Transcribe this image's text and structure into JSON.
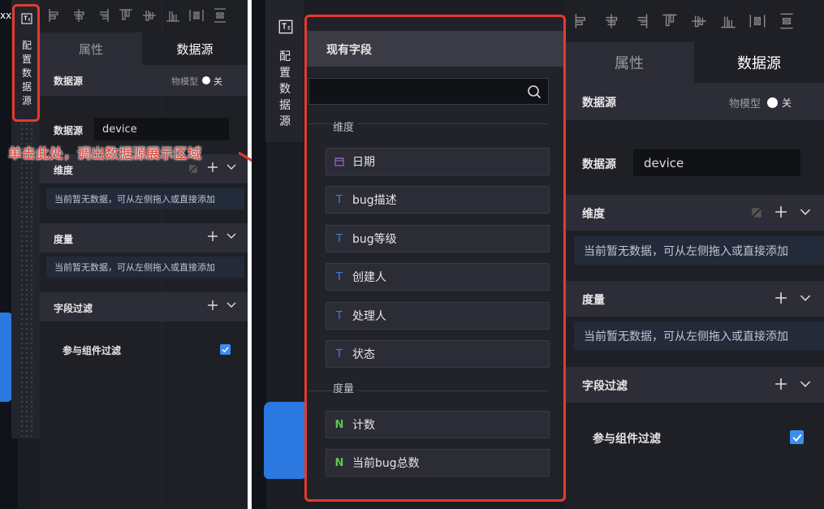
{
  "toolbar": {
    "icons": [
      "align-left-icon",
      "align-center-h-icon",
      "align-right-icon",
      "align-top-icon",
      "align-center-v-icon",
      "align-bottom-icon",
      "distribute-h-icon",
      "distribute-v-icon"
    ]
  },
  "left": {
    "config_label": [
      "配",
      "置",
      "数",
      "据",
      "源"
    ],
    "tabs": {
      "props": "属性",
      "datasource": "数据源"
    },
    "ds_header": "数据源",
    "model_label": "物模型",
    "model_toggle": "关",
    "ds_label": "数据源",
    "ds_value": "device",
    "dimension": "维度",
    "measure": "度量",
    "empty_hint": "当前暂无数据，可从左侧拖入或直接添加",
    "filter": "字段过滤",
    "participate": "参与组件过滤"
  },
  "annotation": {
    "text": "单击此处，调出数据源展示区域"
  },
  "right": {
    "config_label": [
      "配",
      "置",
      "数",
      "据",
      "源"
    ],
    "tabs": {
      "props": "属性",
      "datasource": "数据源"
    },
    "ds_header": "数据源",
    "model_label": "物模型",
    "model_toggle": "关",
    "ds_label": "数据源",
    "ds_value": "device",
    "dimension": "维度",
    "measure": "度量",
    "empty_hint": "当前暂无数据，可从左侧拖入或直接添加",
    "filter": "字段过滤",
    "participate": "参与组件过滤"
  },
  "fields_panel": {
    "title": "现有字段",
    "search_placeholder": "",
    "dimension_group": "维度",
    "dimensions": [
      {
        "type": "date",
        "label": "日期"
      },
      {
        "type": "T",
        "label": "bug描述"
      },
      {
        "type": "T",
        "label": "bug等级"
      },
      {
        "type": "T",
        "label": "创建人"
      },
      {
        "type": "T",
        "label": "处理人"
      },
      {
        "type": "T",
        "label": "状态"
      }
    ],
    "measure_group": "度量",
    "measures": [
      {
        "type": "N",
        "label": "计数"
      },
      {
        "type": "N",
        "label": "当前bug总数"
      }
    ]
  },
  "colors": {
    "accent_red": "#e53a2e",
    "checkbox_blue": "#3b8ef2",
    "panel_bg": "#1f2026"
  }
}
